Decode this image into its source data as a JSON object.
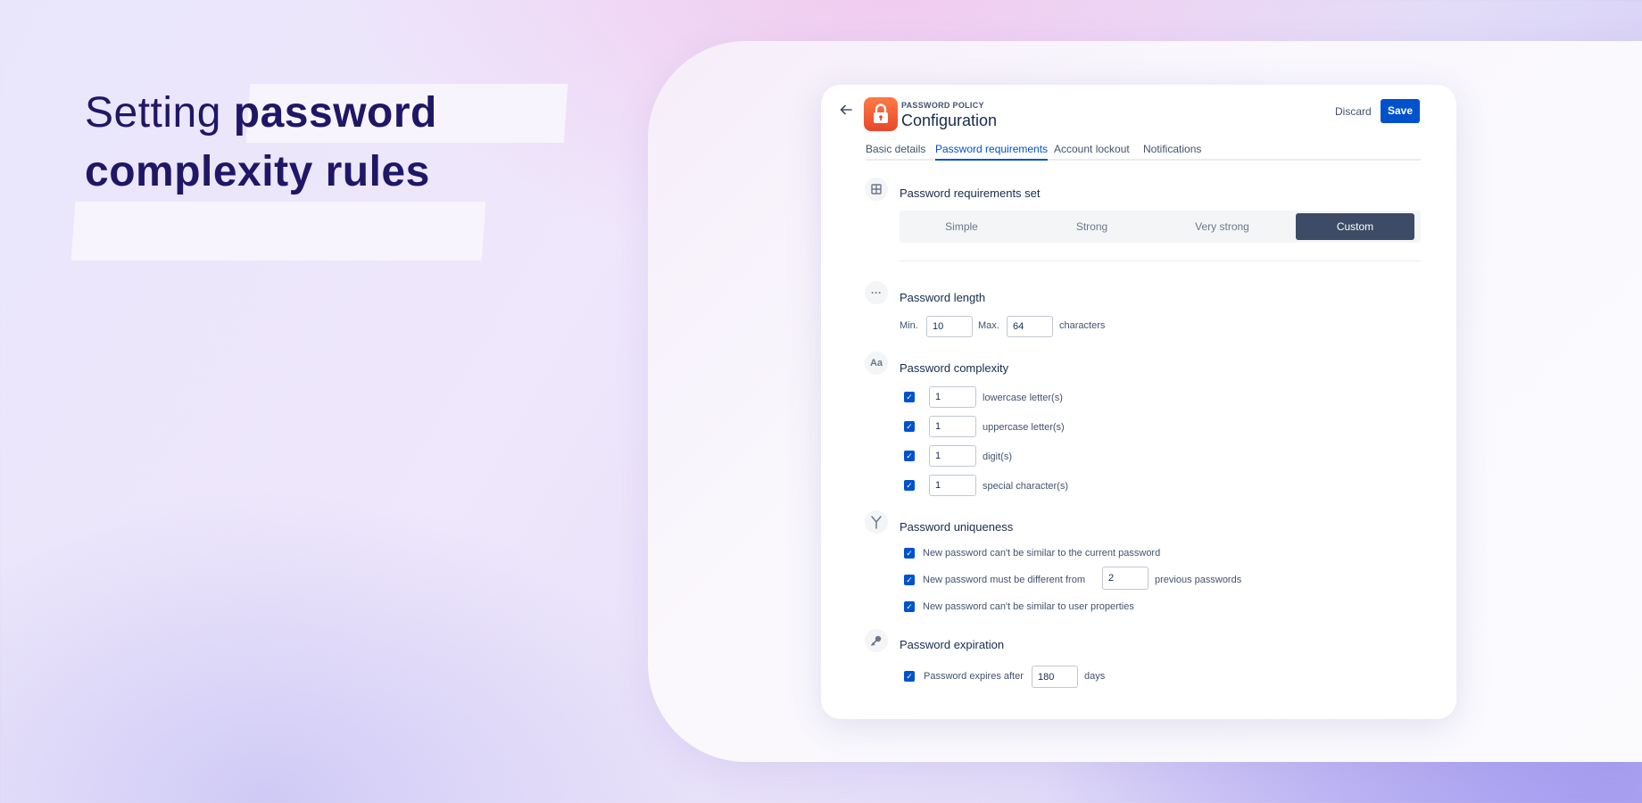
{
  "headline": {
    "light": "Setting",
    "bold_1": "password",
    "bold_2": "complexity rules"
  },
  "header": {
    "subtitle": "PASSWORD POLICY",
    "title": "Configuration",
    "discard_label": "Discard",
    "save_label": "Save"
  },
  "tabs": [
    {
      "label": "Basic details",
      "active": false
    },
    {
      "label": "Password requirements",
      "active": true
    },
    {
      "label": "Account lockout",
      "active": false
    },
    {
      "label": "Notifications",
      "active": false
    }
  ],
  "requirements_set": {
    "title": "Password requirements set",
    "options": [
      "Simple",
      "Strong",
      "Very strong",
      "Custom"
    ],
    "selected": "Custom"
  },
  "length": {
    "title": "Password length",
    "min_label": "Min.",
    "min_value": "10",
    "max_label": "Max.",
    "max_value": "64",
    "unit": "characters"
  },
  "complexity": {
    "title": "Password complexity",
    "rules": [
      {
        "checked": true,
        "value": "1",
        "label": "lowercase letter(s)"
      },
      {
        "checked": true,
        "value": "1",
        "label": "uppercase letter(s)"
      },
      {
        "checked": true,
        "value": "1",
        "label": "digit(s)"
      },
      {
        "checked": true,
        "value": "1",
        "label": "special character(s)"
      }
    ]
  },
  "uniqueness": {
    "title": "Password uniqueness",
    "rule_1": "New password can't be similar to the current password",
    "rule_2_prefix": "New password must be different from",
    "rule_2_value": "2",
    "rule_2_suffix": "previous passwords",
    "rule_3": "New password can't be similar to user properties"
  },
  "expiration": {
    "title": "Password expiration",
    "prefix": "Password expires after",
    "value": "180",
    "suffix": "days"
  },
  "colors": {
    "accent": "#0052cc",
    "segment_selected": "#3d4b66",
    "headline": "#1f1766",
    "app_icon": "#ee5a36"
  }
}
